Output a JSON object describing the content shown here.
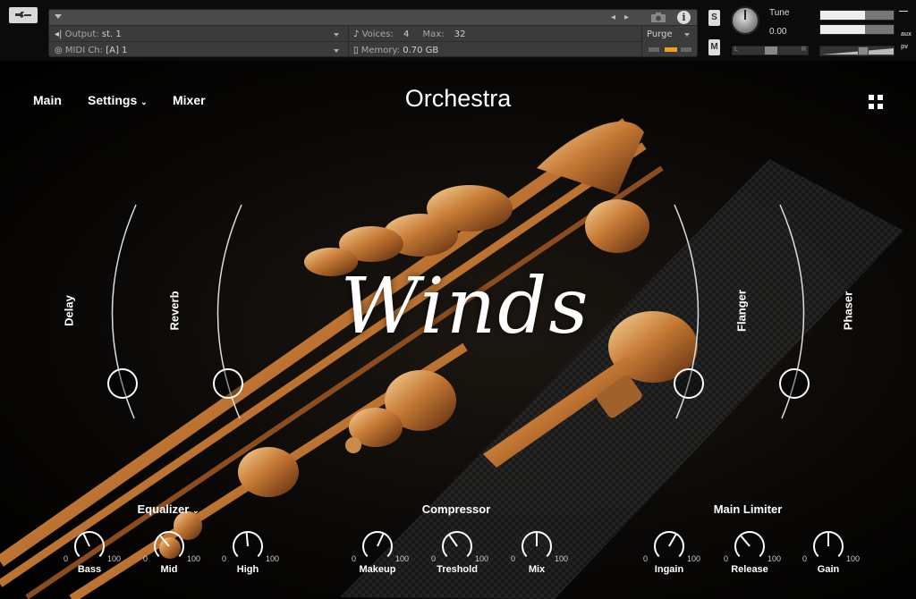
{
  "header": {
    "output_label": "Output:",
    "output_value": "st. 1",
    "midi_label": "MIDI Ch:",
    "midi_value": "[A]  1",
    "voices_label": "Voices:",
    "voices_value": "4",
    "max_label": "Max:",
    "max_value": "32",
    "memory_label": "Memory:",
    "memory_value": "0.70 GB",
    "purge_label": "Purge",
    "solo_label": "S",
    "mute_label": "M",
    "tune_label": "Tune",
    "tune_value": "0.00",
    "pan_left": "L",
    "pan_right": "R",
    "aux_label": "aux",
    "pv_label": "pv",
    "volume_level": 0.6
  },
  "nav": {
    "main": "Main",
    "settings": "Settings",
    "mixer": "Mixer"
  },
  "instrument_title": "Orchestra",
  "wordmark": "Winds",
  "effects": {
    "delay": "Delay",
    "reverb": "Reverb",
    "flanger": "Flanger",
    "phaser": "Phaser"
  },
  "sections": {
    "equalizer": "Equalizer",
    "compressor": "Compressor",
    "limiter": "Main Limiter"
  },
  "knobs": {
    "min": "0",
    "max": "100",
    "bass": "Bass",
    "mid": "Mid",
    "high": "High",
    "makeup": "Makeup",
    "treshold": "Treshold",
    "mix": "Mix",
    "ingain": "Ingain",
    "release": "Release",
    "gain": "Gain"
  },
  "colors": {
    "accent_orange": "#f0a020",
    "background": "#000000"
  }
}
